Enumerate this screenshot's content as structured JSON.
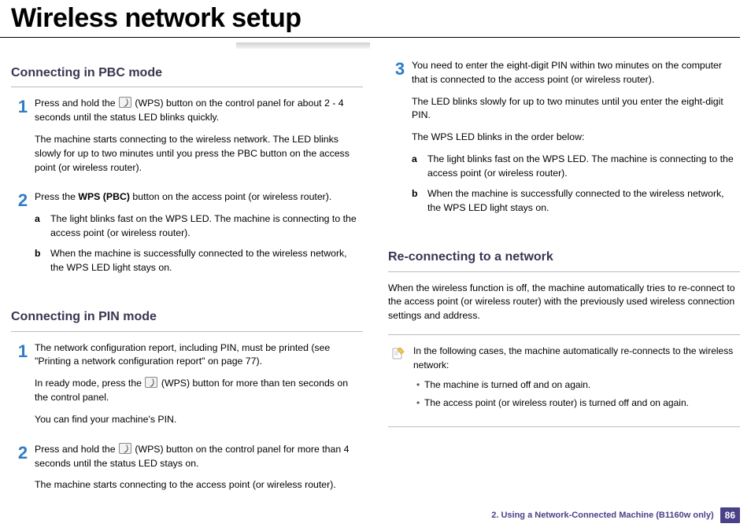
{
  "title": "Wireless network setup",
  "left": {
    "section1": {
      "heading": "Connecting in PBC mode",
      "step1": {
        "num": "1",
        "p1a": "Press and hold the ",
        "p1b": " (WPS) button on the control panel for about 2 - 4 seconds until the status LED blinks quickly.",
        "p2": "The machine starts connecting to the wireless network. The LED blinks slowly for up to two minutes until you press the PBC button on the access point (or wireless router)."
      },
      "step2": {
        "num": "2",
        "p1a": "Press the ",
        "p1b": "WPS (PBC)",
        "p1c": " button on the access point (or wireless router).",
        "a": {
          "letter": "a",
          "text": "The light blinks fast on the WPS LED. The machine is connecting to the access point (or wireless router)."
        },
        "b": {
          "letter": "b",
          "text": "When the machine is successfully connected to the wireless network, the WPS LED light stays on."
        }
      }
    },
    "section2": {
      "heading": "Connecting in PIN mode",
      "step1": {
        "num": "1",
        "p1": "The network configuration report, including PIN, must be printed (see \"Printing a network configuration report\" on page 77).",
        "p2a": "In ready mode, press the ",
        "p2b": " (WPS) button for more than ten seconds on the control panel.",
        "p3": "You can find your machine's PIN."
      },
      "step2": {
        "num": "2",
        "p1a": "Press and hold the ",
        "p1b": " (WPS) button on the control panel for more than 4 seconds until the status LED stays on.",
        "p2": "The machine starts connecting to the access point (or wireless router)."
      }
    }
  },
  "right": {
    "step3": {
      "num": "3",
      "p1": "You need to enter the eight-digit PIN within two minutes on the computer that is connected to the access point (or wireless router).",
      "p2": "The LED blinks slowly for up to two minutes until you enter the eight-digit PIN.",
      "p3": "The WPS LED blinks in the order below:",
      "a": {
        "letter": "a",
        "text": "The light blinks fast on the WPS LED. The machine is connecting to the access point (or wireless router)."
      },
      "b": {
        "letter": "b",
        "text": "When the machine is successfully connected to the wireless network, the WPS LED light stays on."
      }
    },
    "section3": {
      "heading": "Re-connecting to a network",
      "intro": "When the wireless function is off, the machine automatically tries to re-connect to the access point (or wireless router) with the previously used wireless connection settings and address.",
      "note": {
        "line1": "In the following cases, the machine automatically re-connects to the wireless network:",
        "b1": "The machine is turned off and on again.",
        "b2": "The access point (or wireless router) is turned off and on again."
      }
    }
  },
  "footer": {
    "text": "2.  Using a Network-Connected Machine (B1160w only)",
    "page": "86"
  }
}
